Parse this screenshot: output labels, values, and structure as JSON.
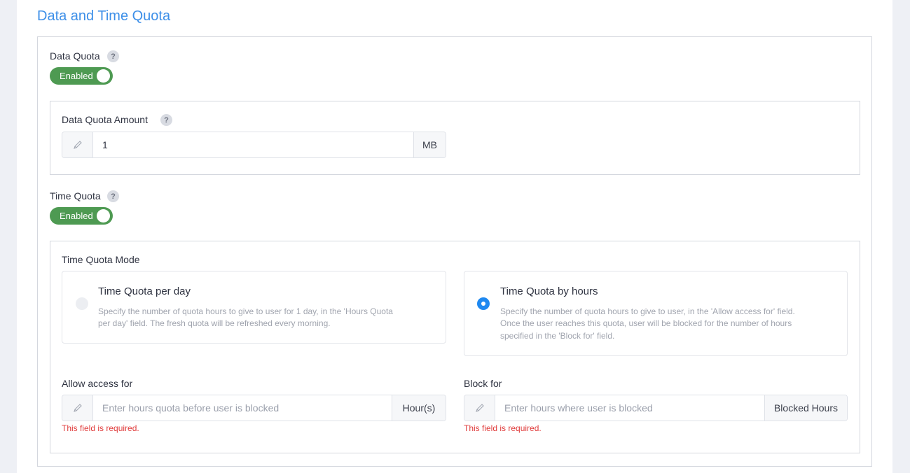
{
  "section": {
    "title": "Data and Time Quota"
  },
  "data_quota": {
    "label": "Data Quota",
    "help": "?",
    "toggle_label": "Enabled",
    "amount": {
      "label": "Data Quota Amount",
      "help": "?",
      "value": "1",
      "unit": "MB"
    }
  },
  "time_quota": {
    "label": "Time Quota",
    "help": "?",
    "toggle_label": "Enabled",
    "mode": {
      "label": "Time Quota Mode",
      "options": [
        {
          "title": "Time Quota per day",
          "desc_lines": [
            "Specify the number of quota hours to give to user for 1 day, in the 'Hours Quota",
            "per day' field. The fresh quota will be refreshed every morning."
          ],
          "selected": false
        },
        {
          "title": "Time Quota by hours",
          "desc_lines": [
            "Specify the number of quota hours to give to user, in the 'Allow access for' field.",
            "Once the user reaches this quota, user will be blocked for the number of hours",
            "specified in the 'Block for' field."
          ],
          "selected": true
        }
      ]
    },
    "allow_access": {
      "label": "Allow access for",
      "placeholder": "Enter hours quota before user is blocked",
      "value": "",
      "unit": "Hour(s)",
      "error": "This field is required."
    },
    "block_for": {
      "label": "Block for",
      "placeholder": "Enter hours where user is blocked",
      "value": "",
      "unit": "Blocked Hours",
      "error": "This field is required."
    }
  },
  "icons": {
    "pencil": "pencil-icon",
    "help": "question-icon"
  },
  "colors": {
    "accent_title": "#3d8fe8",
    "toggle_on": "#4e9a52",
    "radio_selected": "#1e88f0",
    "error": "#e03c3c"
  }
}
